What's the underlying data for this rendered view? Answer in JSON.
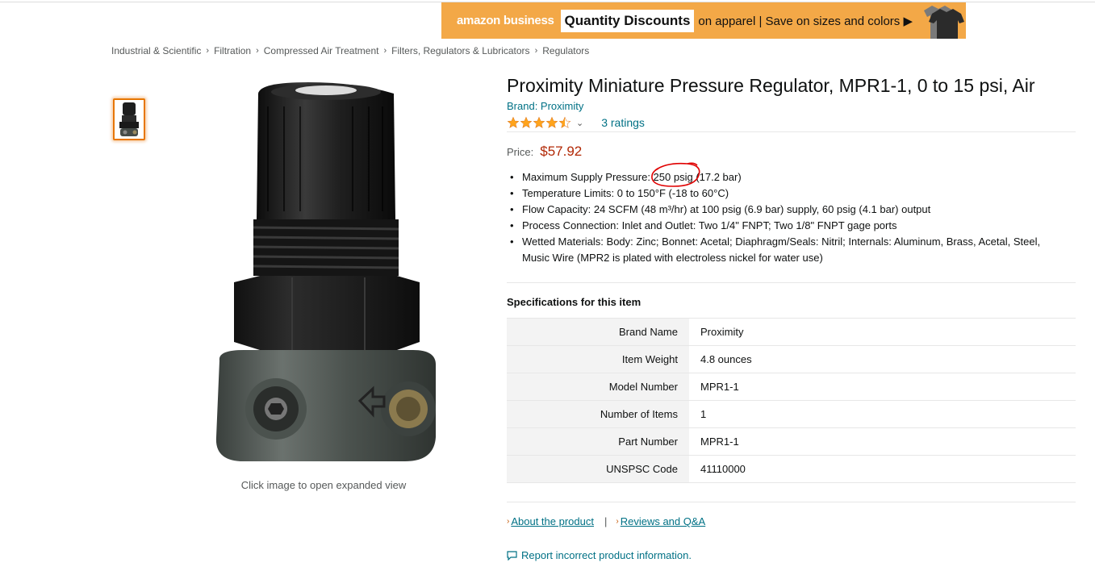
{
  "banner": {
    "logo_text": "amazon business",
    "highlight": "Quantity Discounts",
    "tagline": "on apparel | Save on sizes and colors ▶"
  },
  "breadcrumb": [
    "Industrial & Scientific",
    "Filtration",
    "Compressed Air Treatment",
    "Filters, Regulators & Lubricators",
    "Regulators"
  ],
  "breadcrumb_separator": "›",
  "image": {
    "caption": "Click image to open expanded view"
  },
  "product": {
    "title": "Proximity Miniature Pressure Regulator, MPR1-1, 0 to 15 psi, Air",
    "brand": "Brand: Proximity",
    "star_rating": 4.5,
    "ratings_text": "3 ratings",
    "price_label": "Price:",
    "price_value": "$57.92",
    "bullets": [
      "Maximum Supply Pressure: 250 psig (17.2 bar)",
      "Temperature Limits: 0 to 150°F (-18 to 60°C)",
      "Flow Capacity: 24 SCFM (48 m³/hr) at 100 psig (6.9 bar) supply, 60 psig (4.1 bar) output",
      "Process Connection: Inlet and Outlet: Two 1/4\" FNPT; Two 1/8\" FNPT gage ports",
      "Wetted Materials: Body: Zinc; Bonnet: Acetal; Diaphragm/Seals: Nitril; Internals: Aluminum, Brass, Acetal, Steel, Music Wire (MPR2 is plated with electroless nickel for water use)"
    ]
  },
  "specs": {
    "heading": "Specifications for this item",
    "rows": [
      {
        "key": "Brand Name",
        "value": "Proximity"
      },
      {
        "key": "Item Weight",
        "value": "4.8 ounces"
      },
      {
        "key": "Model Number",
        "value": "MPR1-1"
      },
      {
        "key": "Number of Items",
        "value": "1"
      },
      {
        "key": "Part Number",
        "value": "MPR1-1"
      },
      {
        "key": "UNSPSC Code",
        "value": "41110000"
      }
    ]
  },
  "links": {
    "about": "About the product",
    "separator": "|",
    "reviews": "Reviews and Q&A",
    "report": "Report incorrect product information."
  },
  "colors": {
    "link": "#007185",
    "price": "#B12704",
    "banner_bg": "#F3A847",
    "star": "#FFA41C",
    "annotation": "#E00000"
  }
}
